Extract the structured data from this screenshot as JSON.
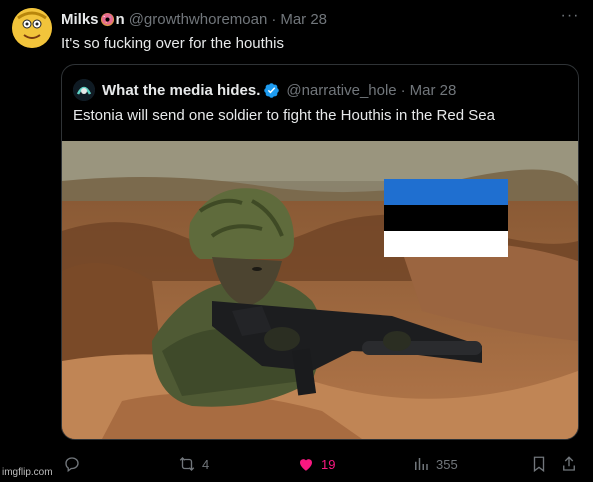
{
  "tweet": {
    "author_name_part1": "Milks",
    "author_name_part2": "n",
    "handle": "@growthwhoremoan",
    "separator": "·",
    "date": "Mar 28",
    "text": "It's so fucking over for the houthis",
    "more_icon": "ellipsis-icon"
  },
  "quote": {
    "author_name": "What the media hides.",
    "verified_icon": "verified-badge-icon",
    "handle": "@narrative_hole",
    "separator": "·",
    "date": "Mar 28",
    "text": "Estonia will send one soldier to fight the Houthis in the Red Sea",
    "image": "soldier-with-estonian-flag-photo"
  },
  "actions": {
    "reply_count": "",
    "retweet_count": "4",
    "like_count": "19",
    "views_count": "355"
  },
  "colors": {
    "background": "#000000",
    "text_primary": "#e7e9ea",
    "text_secondary": "#71767b",
    "like_pink": "#f91880",
    "verified_blue": "#1d9bf0",
    "flag_blue": "#1f6fd0",
    "flag_black": "#000000",
    "flag_white": "#ffffff"
  },
  "watermark": "imgflip.com"
}
